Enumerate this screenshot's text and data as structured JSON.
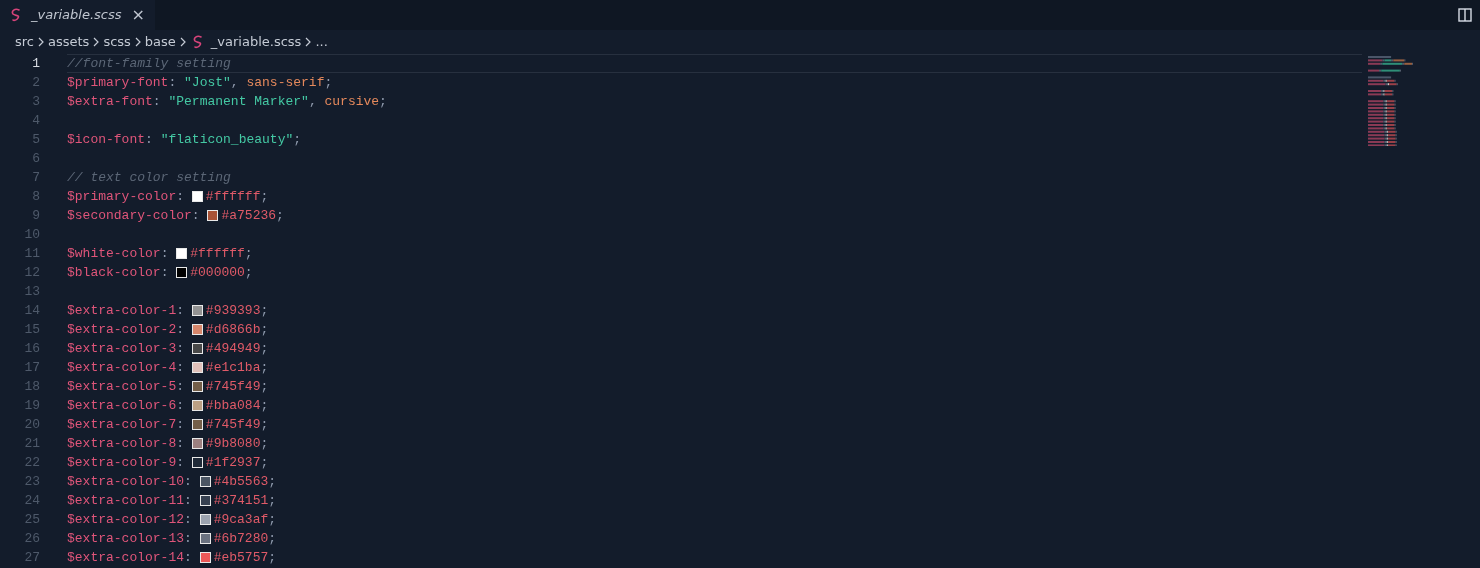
{
  "tab": {
    "label": "_variable.scss",
    "selected": true,
    "close": "×"
  },
  "breadcrumb": [
    "src",
    "assets",
    "scss",
    "base",
    "_variable.scss",
    "..."
  ],
  "lines": [
    {
      "number": "1",
      "current": true,
      "tokens": [
        {
          "kind": "comment",
          "text": "//font-family setting"
        }
      ]
    },
    {
      "number": "2",
      "current": false,
      "tokens": [
        {
          "kind": "variable",
          "text": "$primary-font"
        },
        {
          "kind": "punct",
          "text": ": "
        },
        {
          "kind": "string",
          "text": "\"Jost\""
        },
        {
          "kind": "punct",
          "text": ", "
        },
        {
          "kind": "keyword",
          "text": "sans-serif"
        },
        {
          "kind": "punct",
          "text": ";"
        }
      ]
    },
    {
      "number": "3",
      "current": false,
      "tokens": [
        {
          "kind": "variable",
          "text": "$extra-font"
        },
        {
          "kind": "punct",
          "text": ": "
        },
        {
          "kind": "string",
          "text": "\"Permanent Marker\""
        },
        {
          "kind": "punct",
          "text": ", "
        },
        {
          "kind": "keyword",
          "text": "cursive"
        },
        {
          "kind": "punct",
          "text": ";"
        }
      ]
    },
    {
      "number": "4",
      "current": false
    },
    {
      "number": "5",
      "current": false,
      "tokens": [
        {
          "kind": "variable",
          "text": "$icon-font"
        },
        {
          "kind": "punct",
          "text": ": "
        },
        {
          "kind": "string",
          "text": "\"flaticon_beauty\""
        },
        {
          "kind": "punct",
          "text": ";"
        }
      ]
    },
    {
      "number": "6",
      "current": false
    },
    {
      "number": "7",
      "current": false,
      "tokens": [
        {
          "kind": "comment",
          "text": "// text color setting"
        }
      ]
    },
    {
      "number": "8",
      "current": false,
      "tokens": [
        {
          "kind": "variable",
          "text": "$primary-color"
        },
        {
          "kind": "punct",
          "text": ": "
        },
        {
          "kind": "swatch",
          "color": "#ffffff"
        },
        {
          "kind": "color",
          "text": "#ffffff"
        },
        {
          "kind": "punct",
          "text": ";"
        }
      ]
    },
    {
      "number": "9",
      "current": false,
      "tokens": [
        {
          "kind": "variable",
          "text": "$secondary-color"
        },
        {
          "kind": "punct",
          "text": ": "
        },
        {
          "kind": "swatch",
          "color": "#a75236"
        },
        {
          "kind": "color",
          "text": "#a75236"
        },
        {
          "kind": "punct",
          "text": ";"
        }
      ]
    },
    {
      "number": "10",
      "current": false
    },
    {
      "number": "11",
      "current": false,
      "tokens": [
        {
          "kind": "variable",
          "text": "$white-color"
        },
        {
          "kind": "punct",
          "text": ": "
        },
        {
          "kind": "swatch",
          "color": "#ffffff"
        },
        {
          "kind": "color",
          "text": "#ffffff"
        },
        {
          "kind": "punct",
          "text": ";"
        }
      ]
    },
    {
      "number": "12",
      "current": false,
      "tokens": [
        {
          "kind": "variable",
          "text": "$black-color"
        },
        {
          "kind": "punct",
          "text": ": "
        },
        {
          "kind": "swatch",
          "color": "#000000"
        },
        {
          "kind": "color",
          "text": "#000000"
        },
        {
          "kind": "punct",
          "text": ";"
        }
      ]
    },
    {
      "number": "13",
      "current": false
    },
    {
      "number": "14",
      "current": false,
      "tokens": [
        {
          "kind": "variable",
          "text": "$extra-color-1"
        },
        {
          "kind": "punct",
          "text": ": "
        },
        {
          "kind": "swatch",
          "color": "#939393"
        },
        {
          "kind": "color",
          "text": "#939393"
        },
        {
          "kind": "punct",
          "text": ";"
        }
      ]
    },
    {
      "number": "15",
      "current": false,
      "tokens": [
        {
          "kind": "variable",
          "text": "$extra-color-2"
        },
        {
          "kind": "punct",
          "text": ": "
        },
        {
          "kind": "swatch",
          "color": "#d6866b"
        },
        {
          "kind": "color",
          "text": "#d6866b"
        },
        {
          "kind": "punct",
          "text": ";"
        }
      ]
    },
    {
      "number": "16",
      "current": false,
      "tokens": [
        {
          "kind": "variable",
          "text": "$extra-color-3"
        },
        {
          "kind": "punct",
          "text": ": "
        },
        {
          "kind": "swatch",
          "color": "#494949"
        },
        {
          "kind": "color",
          "text": "#494949"
        },
        {
          "kind": "punct",
          "text": ";"
        }
      ]
    },
    {
      "number": "17",
      "current": false,
      "tokens": [
        {
          "kind": "variable",
          "text": "$extra-color-4"
        },
        {
          "kind": "punct",
          "text": ": "
        },
        {
          "kind": "swatch",
          "color": "#e1c1ba"
        },
        {
          "kind": "color",
          "text": "#e1c1ba"
        },
        {
          "kind": "punct",
          "text": ";"
        }
      ]
    },
    {
      "number": "18",
      "current": false,
      "tokens": [
        {
          "kind": "variable",
          "text": "$extra-color-5"
        },
        {
          "kind": "punct",
          "text": ": "
        },
        {
          "kind": "swatch",
          "color": "#745f49"
        },
        {
          "kind": "color",
          "text": "#745f49"
        },
        {
          "kind": "punct",
          "text": ";"
        }
      ]
    },
    {
      "number": "19",
      "current": false,
      "tokens": [
        {
          "kind": "variable",
          "text": "$extra-color-6"
        },
        {
          "kind": "punct",
          "text": ": "
        },
        {
          "kind": "swatch",
          "color": "#bba084"
        },
        {
          "kind": "color",
          "text": "#bba084"
        },
        {
          "kind": "punct",
          "text": ";"
        }
      ]
    },
    {
      "number": "20",
      "current": false,
      "tokens": [
        {
          "kind": "variable",
          "text": "$extra-color-7"
        },
        {
          "kind": "punct",
          "text": ": "
        },
        {
          "kind": "swatch",
          "color": "#745f49"
        },
        {
          "kind": "color",
          "text": "#745f49"
        },
        {
          "kind": "punct",
          "text": ";"
        }
      ]
    },
    {
      "number": "21",
      "current": false,
      "tokens": [
        {
          "kind": "variable",
          "text": "$extra-color-8"
        },
        {
          "kind": "punct",
          "text": ": "
        },
        {
          "kind": "swatch",
          "color": "#9b8080"
        },
        {
          "kind": "color",
          "text": "#9b8080"
        },
        {
          "kind": "punct",
          "text": ";"
        }
      ]
    },
    {
      "number": "22",
      "current": false,
      "tokens": [
        {
          "kind": "variable",
          "text": "$extra-color-9"
        },
        {
          "kind": "punct",
          "text": ": "
        },
        {
          "kind": "swatch",
          "color": "#1f2937"
        },
        {
          "kind": "color",
          "text": "#1f2937"
        },
        {
          "kind": "punct",
          "text": ";"
        }
      ]
    },
    {
      "number": "23",
      "current": false,
      "tokens": [
        {
          "kind": "variable",
          "text": "$extra-color-10"
        },
        {
          "kind": "punct",
          "text": ": "
        },
        {
          "kind": "swatch",
          "color": "#4b5563"
        },
        {
          "kind": "color",
          "text": "#4b5563"
        },
        {
          "kind": "punct",
          "text": ";"
        }
      ]
    },
    {
      "number": "24",
      "current": false,
      "tokens": [
        {
          "kind": "variable",
          "text": "$extra-color-11"
        },
        {
          "kind": "punct",
          "text": ": "
        },
        {
          "kind": "swatch",
          "color": "#374151"
        },
        {
          "kind": "color",
          "text": "#374151"
        },
        {
          "kind": "punct",
          "text": ";"
        }
      ]
    },
    {
      "number": "25",
      "current": false,
      "tokens": [
        {
          "kind": "variable",
          "text": "$extra-color-12"
        },
        {
          "kind": "punct",
          "text": ": "
        },
        {
          "kind": "swatch",
          "color": "#9ca3af"
        },
        {
          "kind": "color",
          "text": "#9ca3af"
        },
        {
          "kind": "punct",
          "text": ";"
        }
      ]
    },
    {
      "number": "26",
      "current": false,
      "tokens": [
        {
          "kind": "variable",
          "text": "$extra-color-13"
        },
        {
          "kind": "punct",
          "text": ": "
        },
        {
          "kind": "swatch",
          "color": "#6b7280"
        },
        {
          "kind": "color",
          "text": "#6b7280"
        },
        {
          "kind": "punct",
          "text": ";"
        }
      ]
    },
    {
      "number": "27",
      "current": false,
      "tokens": [
        {
          "kind": "variable",
          "text": "$extra-color-14"
        },
        {
          "kind": "punct",
          "text": ": "
        },
        {
          "kind": "swatch",
          "color": "#eb5757"
        },
        {
          "kind": "color",
          "text": "#eb5757"
        },
        {
          "kind": "punct",
          "text": ";"
        }
      ]
    }
  ]
}
